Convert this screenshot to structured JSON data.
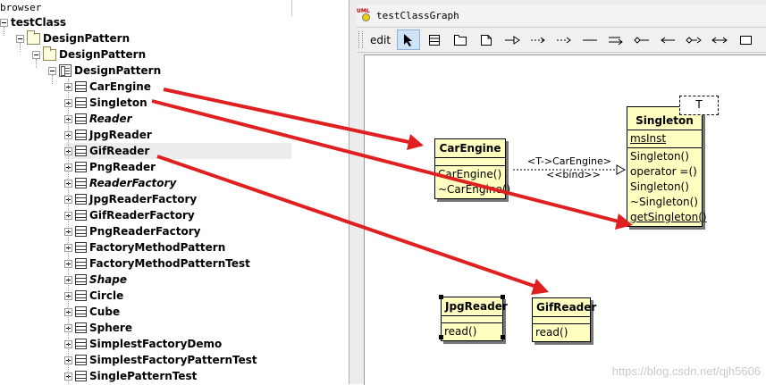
{
  "browser": {
    "title": "browser",
    "tree": [
      {
        "label": "testClass",
        "type": "project",
        "italic": false
      },
      {
        "label": "DesignPattern",
        "type": "folder",
        "italic": false
      },
      {
        "label": "DesignPattern",
        "type": "folder",
        "italic": false
      },
      {
        "label": "DesignPattern",
        "type": "diagram",
        "italic": false
      },
      {
        "label": "CarEngine",
        "type": "class",
        "italic": false
      },
      {
        "label": "Singleton",
        "type": "class",
        "italic": false
      },
      {
        "label": "Reader",
        "type": "class",
        "italic": true
      },
      {
        "label": "JpgReader",
        "type": "class",
        "italic": false
      },
      {
        "label": "GifReader",
        "type": "class",
        "italic": false,
        "highlighted": true
      },
      {
        "label": "PngReader",
        "type": "class",
        "italic": false
      },
      {
        "label": "ReaderFactory",
        "type": "class",
        "italic": true
      },
      {
        "label": "JpgReaderFactory",
        "type": "class",
        "italic": false
      },
      {
        "label": "GifReaderFactory",
        "type": "class",
        "italic": false
      },
      {
        "label": "PngReaderFactory",
        "type": "class",
        "italic": false
      },
      {
        "label": "FactoryMethodPattern",
        "type": "class",
        "italic": false
      },
      {
        "label": "FactoryMethodPatternTest",
        "type": "class",
        "italic": false
      },
      {
        "label": "Shape",
        "type": "class",
        "italic": true
      },
      {
        "label": "Circle",
        "type": "class",
        "italic": false
      },
      {
        "label": "Cube",
        "type": "class",
        "italic": false
      },
      {
        "label": "Sphere",
        "type": "class",
        "italic": false
      },
      {
        "label": "SimplestFactoryDemo",
        "type": "class",
        "italic": false
      },
      {
        "label": "SimplestFactoryPatternTest",
        "type": "class",
        "italic": false
      },
      {
        "label": "SinglePatternTest",
        "type": "class",
        "italic": false
      }
    ]
  },
  "window": {
    "title": "testClassGraph",
    "icon": "uml-class-diagram-icon"
  },
  "toolbar": {
    "edit_label": "edit",
    "tools": [
      "select-arrow-icon",
      "class-icon",
      "package-icon",
      "note-icon",
      "generalisation-icon",
      "dependency-icon",
      "realization-icon",
      "line-icon",
      "directional-association-icon",
      "aggregation-icon",
      "association-arrow-icon",
      "composition-icon",
      "bidirectional-association-icon",
      "anchor-icon"
    ]
  },
  "diagram": {
    "classes": {
      "carengine": {
        "name": "CarEngine",
        "attributes": [],
        "operations": [
          "CarEngine()",
          "~CarEngine()"
        ]
      },
      "singleton": {
        "name": "Singleton",
        "template_param": "T",
        "attributes": [
          {
            "text": "msInst",
            "static": true
          }
        ],
        "operations": [
          {
            "text": "Singleton()",
            "static": false
          },
          {
            "text": "operator =()",
            "static": false
          },
          {
            "text": "Singleton()",
            "static": false
          },
          {
            "text": "~Singleton()",
            "static": false
          },
          {
            "text": "getSingleton()",
            "static": true
          }
        ]
      },
      "jpgreader": {
        "name": "JpgReader",
        "operations": [
          "read()"
        ],
        "selected": true
      },
      "gifreader": {
        "name": "GifReader",
        "operations": [
          "read()"
        ]
      }
    },
    "relation": {
      "binding": "<T->CarEngine>",
      "stereotype": "<<bind>>"
    }
  },
  "annotation_arrow_color": "#e02020",
  "watermark": "https://blog.csdn.net/qjh5606"
}
